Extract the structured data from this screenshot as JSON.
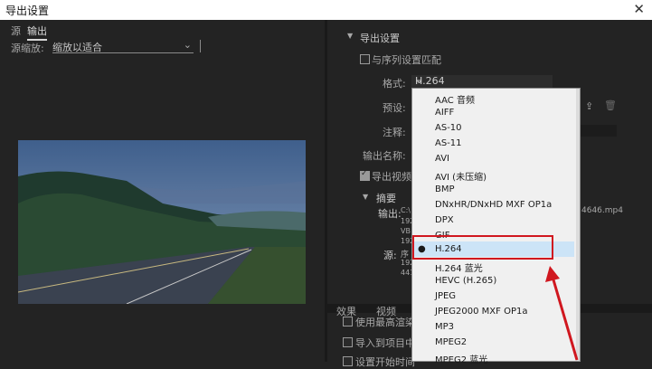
{
  "window": {
    "title": "导出设置",
    "close_glyph": "✕"
  },
  "left": {
    "tabs": [
      "源",
      "输出"
    ],
    "scale_label": "源缩放:",
    "scale_value": "缩放以适合"
  },
  "right": {
    "section_title": "导出设置",
    "match_sequence": "与序列设置匹配",
    "format_label": "格式:",
    "format_value": "H.264",
    "preset_label": "预设:",
    "comments_label": "注释:",
    "output_name_label": "输出名称:",
    "export_video_label": "导出视频",
    "summary_title": "摘要",
    "output_label": "输出:",
    "output_path_fragment": "C:\\",
    "output_file_suffix": "4646.mp4",
    "output_line2": "192",
    "output_line3": "VB",
    "output_line4": "192",
    "source_label": "源:",
    "source_line1": "序",
    "source_line2": "192",
    "source_line3": "441",
    "bottom_tabs": [
      "效果",
      "视频"
    ],
    "bottom_checks": [
      "使用最高渲染",
      "导入到项目中",
      "设置开始时间"
    ]
  },
  "dropdown": {
    "options": [
      "AAC 音频",
      "AIFF",
      "AS-10",
      "AS-11",
      "AVI",
      "AVI (未压缩)",
      "BMP",
      "DNxHR/DNxHD MXF OP1a",
      "DPX",
      "GIF",
      "H.264",
      "H.264 蓝光",
      "HEVC (H.265)",
      "JPEG",
      "JPEG2000 MXF OP1a",
      "MP3",
      "MPEG2",
      "MPEG2 蓝光"
    ],
    "selected": "H.264"
  },
  "colors": {
    "highlight": "#d0171f",
    "selection": "#cce4f7"
  }
}
